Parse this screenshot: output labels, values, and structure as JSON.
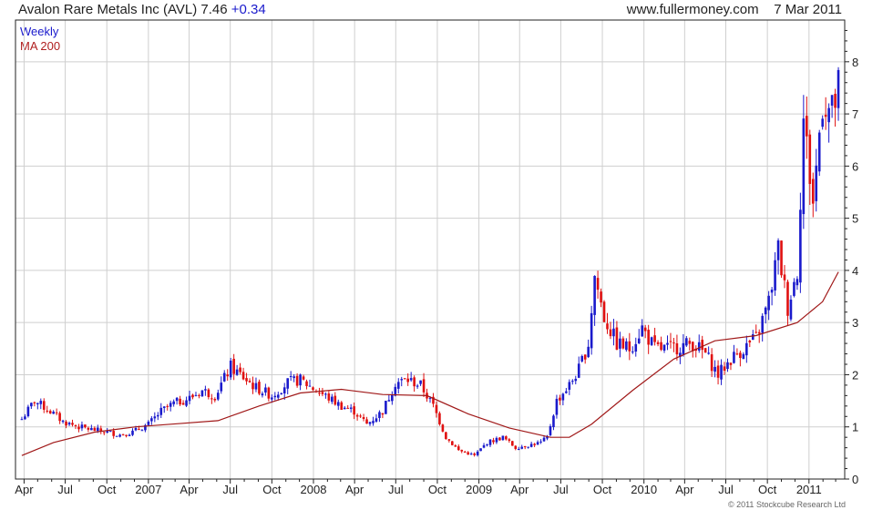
{
  "header": {
    "title": "Avalon Rare Metals Inc (AVL)",
    "price": "7.46",
    "change": "+0.34",
    "site": "www.fullermoney.com",
    "date": "7 Mar 2011"
  },
  "legend": {
    "weekly": "Weekly",
    "ma": "MA 200"
  },
  "copyright": "© 2011 Stockcube Research Ltd",
  "colors": {
    "up": "#1a1acc",
    "down": "#e01010",
    "ma": "#a01818",
    "grid": "#cfcfcf",
    "axis": "#222222"
  },
  "chart_data": {
    "type": "candlestick",
    "title": "Avalon Rare Metals Inc (AVL) 7.46 +0.34",
    "ylim": [
      0,
      8.8
    ],
    "grid": true,
    "x_tick_labels": [
      "Apr",
      "Jul",
      "Oct",
      "2007",
      "Apr",
      "Jul",
      "Oct",
      "2008",
      "Apr",
      "Jul",
      "Oct",
      "2009",
      "Apr",
      "Jul",
      "Oct",
      "2010",
      "Apr",
      "Jul",
      "Oct",
      "2011"
    ],
    "y_tick_labels": [
      "0",
      "1",
      "2",
      "3",
      "4",
      "5",
      "6",
      "7",
      "8"
    ],
    "price_path": [
      [
        "2006-03-27",
        1.15
      ],
      [
        "2006-04-24",
        1.5
      ],
      [
        "2006-05-29",
        1.3
      ],
      [
        "2006-06-26",
        1.1
      ],
      [
        "2006-07-31",
        1.0
      ],
      [
        "2006-08-28",
        0.95
      ],
      [
        "2006-10-02",
        0.9
      ],
      [
        "2006-10-30",
        0.85
      ],
      [
        "2006-11-27",
        0.9
      ],
      [
        "2007-01-01",
        1.05
      ],
      [
        "2007-01-29",
        1.3
      ],
      [
        "2007-02-26",
        1.45
      ],
      [
        "2007-04-02",
        1.55
      ],
      [
        "2007-04-30",
        1.7
      ],
      [
        "2007-05-28",
        1.6
      ],
      [
        "2007-07-02",
        2.15
      ],
      [
        "2007-07-30",
        1.95
      ],
      [
        "2007-08-27",
        1.75
      ],
      [
        "2007-10-01",
        1.6
      ],
      [
        "2007-11-05",
        1.85
      ],
      [
        "2007-12-03",
        1.9
      ],
      [
        "2008-01-07",
        1.7
      ],
      [
        "2008-02-04",
        1.55
      ],
      [
        "2008-03-03",
        1.4
      ],
      [
        "2008-03-31",
        1.3
      ],
      [
        "2008-04-28",
        1.05
      ],
      [
        "2008-06-02",
        1.3
      ],
      [
        "2008-06-30",
        1.85
      ],
      [
        "2008-07-28",
        1.9
      ],
      [
        "2008-08-25",
        1.8
      ],
      [
        "2008-09-22",
        1.4
      ],
      [
        "2008-10-20",
        0.8
      ],
      [
        "2008-11-17",
        0.55
      ],
      [
        "2008-12-22",
        0.45
      ],
      [
        "2009-01-19",
        0.7
      ],
      [
        "2009-02-23",
        0.8
      ],
      [
        "2009-03-23",
        0.6
      ],
      [
        "2009-04-20",
        0.65
      ],
      [
        "2009-05-18",
        0.7
      ],
      [
        "2009-06-01",
        0.8
      ],
      [
        "2009-06-22",
        1.5
      ],
      [
        "2009-07-20",
        1.8
      ],
      [
        "2009-08-10",
        2.1
      ],
      [
        "2009-08-31",
        2.6
      ],
      [
        "2009-09-14",
        3.9
      ],
      [
        "2009-10-05",
        3.1
      ],
      [
        "2009-11-02",
        2.6
      ],
      [
        "2009-11-30",
        2.5
      ],
      [
        "2009-12-28",
        2.9
      ],
      [
        "2010-01-25",
        2.5
      ],
      [
        "2010-02-22",
        2.5
      ],
      [
        "2010-03-22",
        2.55
      ],
      [
        "2010-04-19",
        2.6
      ],
      [
        "2010-05-17",
        2.4
      ],
      [
        "2010-06-14",
        2.0
      ],
      [
        "2010-07-12",
        2.3
      ],
      [
        "2010-08-09",
        2.5
      ],
      [
        "2010-09-06",
        2.7
      ],
      [
        "2010-10-04",
        3.4
      ],
      [
        "2010-10-25",
        4.4
      ],
      [
        "2010-11-15",
        3.3
      ],
      [
        "2010-12-06",
        4.0
      ],
      [
        "2010-12-20",
        6.9
      ],
      [
        "2011-01-10",
        5.3
      ],
      [
        "2011-01-31",
        7.3
      ],
      [
        "2011-02-21",
        7.0
      ],
      [
        "2011-03-07",
        7.46
      ]
    ],
    "series": [
      {
        "name": "MA 200",
        "points": [
          [
            "2006-03-27",
            0.45
          ],
          [
            "2006-06-05",
            0.7
          ],
          [
            "2006-09-04",
            0.9
          ],
          [
            "2006-12-04",
            1.0
          ],
          [
            "2007-03-05",
            1.06
          ],
          [
            "2007-06-04",
            1.12
          ],
          [
            "2007-09-03",
            1.4
          ],
          [
            "2007-12-03",
            1.65
          ],
          [
            "2008-03-03",
            1.72
          ],
          [
            "2008-06-02",
            1.62
          ],
          [
            "2008-09-08",
            1.6
          ],
          [
            "2008-12-08",
            1.25
          ],
          [
            "2009-03-09",
            0.98
          ],
          [
            "2009-06-08",
            0.8
          ],
          [
            "2009-07-20",
            0.8
          ],
          [
            "2009-09-07",
            1.05
          ],
          [
            "2009-12-07",
            1.7
          ],
          [
            "2010-03-08",
            2.3
          ],
          [
            "2010-06-07",
            2.65
          ],
          [
            "2010-09-06",
            2.75
          ],
          [
            "2010-12-06",
            3.0
          ],
          [
            "2011-01-31",
            3.4
          ],
          [
            "2011-03-07",
            3.97
          ]
        ]
      }
    ]
  }
}
